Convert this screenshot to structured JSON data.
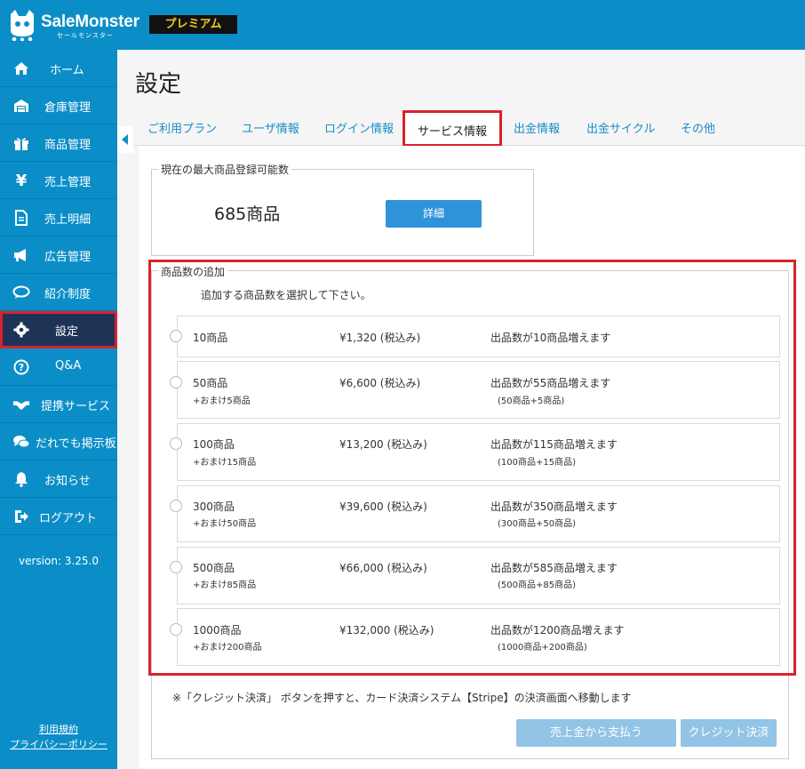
{
  "brand": {
    "name": "SaleMonster",
    "sub": "セールモンスター",
    "badge": "プレミアム"
  },
  "sidebar": {
    "items": [
      {
        "label": "ホーム",
        "icon": "home-icon"
      },
      {
        "label": "倉庫管理",
        "icon": "warehouse-icon"
      },
      {
        "label": "商品管理",
        "icon": "gift-icon"
      },
      {
        "label": "売上管理",
        "icon": "yen-icon"
      },
      {
        "label": "売上明細",
        "icon": "document-icon"
      },
      {
        "label": "広告管理",
        "icon": "megaphone-icon"
      },
      {
        "label": "紹介制度",
        "icon": "speech-bubble-icon"
      },
      {
        "label": "設定",
        "icon": "gear-icon"
      },
      {
        "label": "Q&A",
        "icon": "question-icon"
      },
      {
        "label": "提携サービス",
        "icon": "handshake-icon"
      },
      {
        "label": "だれでも掲示板",
        "icon": "comments-icon"
      },
      {
        "label": "お知らせ",
        "icon": "bell-icon"
      },
      {
        "label": "ログアウト",
        "icon": "logout-icon"
      }
    ],
    "version": "version: 3.25.0",
    "terms": "利用規約",
    "privacy": "プライバシーポリシー"
  },
  "page": {
    "title": "設定"
  },
  "tabs": [
    "ご利用プラン",
    "ユーザ情報",
    "ログイン情報",
    "サービス情報",
    "出金情報",
    "出金サイクル",
    "その他"
  ],
  "current": {
    "legend": "現在の最大商品登録可能数",
    "count": "685商品",
    "detail_button": "詳細"
  },
  "add": {
    "legend": "商品数の追加",
    "instruction": "追加する商品数を選択して下さい。",
    "options": [
      {
        "name": "10商品",
        "bonus": "",
        "price": "¥1,320 (税込み)",
        "increase": "出品数が10商品増えます",
        "detail": ""
      },
      {
        "name": "50商品",
        "bonus": "+おまけ5商品",
        "price": "¥6,600 (税込み)",
        "increase": "出品数が55商品増えます",
        "detail": "(50商品+5商品)"
      },
      {
        "name": "100商品",
        "bonus": "+おまけ15商品",
        "price": "¥13,200 (税込み)",
        "increase": "出品数が115商品増えます",
        "detail": "(100商品+15商品)"
      },
      {
        "name": "300商品",
        "bonus": "+おまけ50商品",
        "price": "¥39,600 (税込み)",
        "increase": "出品数が350商品増えます",
        "detail": "(300商品+50商品)"
      },
      {
        "name": "500商品",
        "bonus": "+おまけ85商品",
        "price": "¥66,000 (税込み)",
        "increase": "出品数が585商品増えます",
        "detail": "(500商品+85商品)"
      },
      {
        "name": "1000商品",
        "bonus": "+おまけ200商品",
        "price": "¥132,000 (税込み)",
        "increase": "出品数が1200商品増えます",
        "detail": "(1000商品+200商品)"
      }
    ]
  },
  "note": "※「クレジット決済」 ボタンを押すと、カード決済システム【Stripe】の決済画面へ移動します",
  "buttons": {
    "pay_from_sales": "売上金から支払う",
    "credit": "クレジット決済"
  },
  "colors": {
    "brand_blue": "#0b8ec8",
    "active_nav": "#1e3355",
    "highlight_red": "#d8232f",
    "button_blue": "#2f93da",
    "disabled_blue": "#92c4e6",
    "badge_gold": "#f3c81b"
  }
}
